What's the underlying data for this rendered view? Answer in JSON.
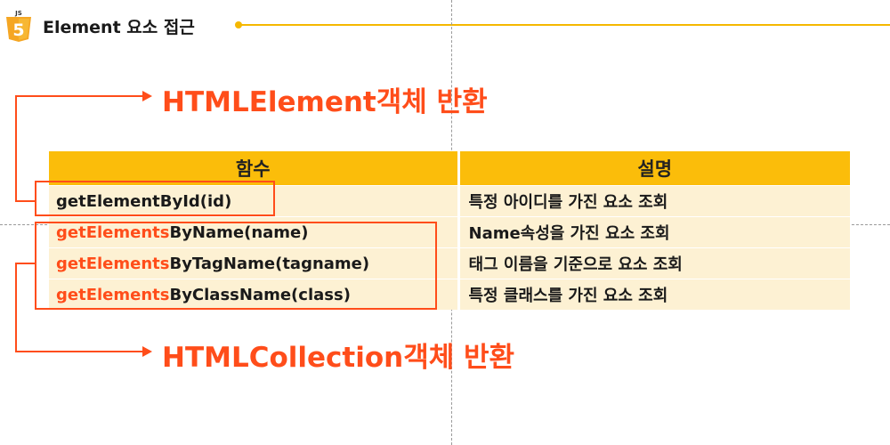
{
  "header": {
    "logo_text": "JS",
    "logo_number": "5",
    "title": "Element 요소 접근"
  },
  "callouts": {
    "top": "HTMLElement객체 반환",
    "bottom": "HTMLCollection객체 반환"
  },
  "table": {
    "headers": [
      "함수",
      "설명"
    ],
    "rows": [
      {
        "prefix": "",
        "function": "getElementById(id)",
        "description": "특정 아이디를 가진 요소 조회"
      },
      {
        "prefix": "getElements",
        "function": "ByName(name)",
        "description": "Name속성을 가진 요소 조회"
      },
      {
        "prefix": "getElements",
        "function": "ByTagName(tagname)",
        "description": "태그 이름을 기준으로 요소 조회"
      },
      {
        "prefix": "getElements",
        "function": "ByClassName(class)",
        "description": "특정 클래스를 가진 요소 조회"
      }
    ]
  },
  "colors": {
    "accent": "#ff4d1a",
    "header_fill": "#fbbd0a",
    "row_fill": "#fdf1d3",
    "rule": "#f5b800",
    "logo": "#f5a623"
  },
  "icons": {
    "logo": "html5-js-shield-icon"
  }
}
